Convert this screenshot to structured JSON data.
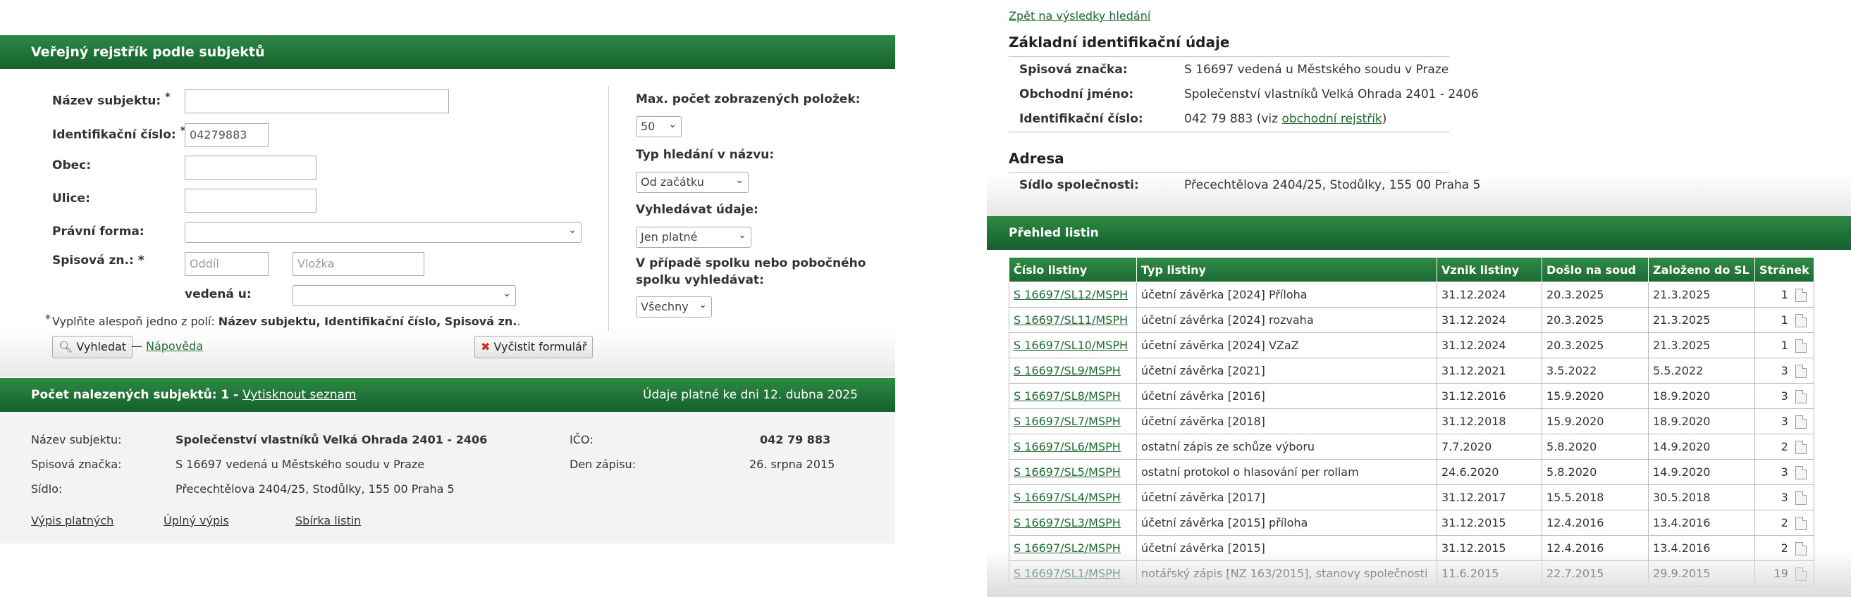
{
  "search": {
    "title": "Veřejný rejstřík podle subjektů",
    "labels": {
      "name": "Název subjektu:",
      "ico": "Identifikační číslo:",
      "city": "Obec:",
      "street": "Ulice:",
      "legal_form": "Právní forma:",
      "file_no": "Spisová zn.:",
      "court": "vedená u:",
      "required_mark": "*"
    },
    "values": {
      "name": "",
      "ico": "04279883",
      "city": "",
      "street": "",
      "legal_form": "",
      "court": ""
    },
    "placeholders": {
      "section": "Oddíl",
      "insert": "Vložka"
    },
    "options": {
      "max_label": "Max. počet zobrazených položek:",
      "max_value": "50",
      "type_label": "Typ hledání v názvu:",
      "type_value": "Od začátku",
      "data_label": "Vyhledávat údaje:",
      "data_value": "Jen platné",
      "assoc_label_1": "V případě spolku nebo pobočného",
      "assoc_label_2": "spolku vyhledávat:",
      "assoc_value": "Všechny"
    },
    "note_prefix": "Vyplňte alespoň jedno z polí:",
    "note_fields": "Název subjektu, Identifikační číslo, Spisová zn.",
    "note_end": ".",
    "search_button": "Vyhledat",
    "dash": "—",
    "help_link": "Nápověda",
    "clear_button": "Vyčistit formulář"
  },
  "results": {
    "count_label": "Počet nalezených subjektů: 1 -",
    "print_link": "Vytisknout seznam",
    "valid_note": "Údaje platné ke dni 12. dubna 2025",
    "name_label": "Název subjektu:",
    "name_value": "Společenství vlastníků Velká Ohrada 2401 - 2406",
    "file_label": "Spisová značka:",
    "file_value": "S 16697 vedená u Městského soudu v Praze",
    "seat_label": "Sídlo:",
    "seat_value": "Přecechtělova 2404/25, Stodůlky, 155 00 Praha 5",
    "ico_label": "IČO:",
    "ico_value": "042 79 883",
    "date_label": "Den zápisu:",
    "date_value": "26. srpna 2015",
    "links": [
      "Výpis platných",
      "Úplný výpis",
      "Sbírka listin"
    ]
  },
  "detail": {
    "back_link": "Zpět na výsledky hledání",
    "basic_title": "Základní identifikační údaje",
    "file_label": "Spisová značka:",
    "file_value": "S 16697 vedená u Městského soudu v Praze",
    "name_label": "Obchodní jméno:",
    "name_value": "Společenství vlastníků Velká Ohrada 2401 - 2406",
    "ico_label": "Identifikační číslo:",
    "ico_value": "042 79 883 (viz",
    "ico_link": "obchodní rejstřík",
    "ico_end": ")",
    "address_title": "Adresa",
    "seat_label": "Sídlo společnosti:",
    "seat_value": "Přecechtělova 2404/25, Stodůlky, 155 00 Praha 5"
  },
  "listiny": {
    "title": "Přehled listin",
    "columns": [
      "Číslo listiny",
      "Typ listiny",
      "Vznik listiny",
      "Došlo na soud",
      "Založeno do SL",
      "Stránek"
    ],
    "rows": [
      [
        "S 16697/SL12/MSPH",
        "účetní závěrka [2024] Příloha",
        "31.12.2024",
        "20.3.2025",
        "21.3.2025",
        "1"
      ],
      [
        "S 16697/SL11/MSPH",
        "účetní závěrka [2024] rozvaha",
        "31.12.2024",
        "20.3.2025",
        "21.3.2025",
        "1"
      ],
      [
        "S 16697/SL10/MSPH",
        "účetní závěrka [2024] VZaZ",
        "31.12.2024",
        "20.3.2025",
        "21.3.2025",
        "1"
      ],
      [
        "S 16697/SL9/MSPH",
        "účetní závěrka [2021]",
        "31.12.2021",
        "3.5.2022",
        "5.5.2022",
        "3"
      ],
      [
        "S 16697/SL8/MSPH",
        "účetní závěrka [2016]",
        "31.12.2016",
        "15.9.2020",
        "18.9.2020",
        "3"
      ],
      [
        "S 16697/SL7/MSPH",
        "účetní závěrka [2018]",
        "31.12.2018",
        "15.9.2020",
        "18.9.2020",
        "3"
      ],
      [
        "S 16697/SL6/MSPH",
        "ostatní zápis ze schůze výboru",
        "7.7.2020",
        "5.8.2020",
        "14.9.2020",
        "2"
      ],
      [
        "S 16697/SL5/MSPH",
        "ostatní protokol o hlasování per rollam",
        "24.6.2020",
        "5.8.2020",
        "14.9.2020",
        "3"
      ],
      [
        "S 16697/SL4/MSPH",
        "účetní závěrka [2017]",
        "31.12.2017",
        "15.5.2018",
        "30.5.2018",
        "3"
      ],
      [
        "S 16697/SL3/MSPH",
        "účetní závěrka [2015] příloha",
        "31.12.2015",
        "12.4.2016",
        "13.4.2016",
        "2"
      ],
      [
        "S 16697/SL2/MSPH",
        "účetní závěrka [2015]",
        "31.12.2015",
        "12.4.2016",
        "13.4.2016",
        "2"
      ],
      [
        "S 16697/SL1/MSPH",
        "notářský zápis [NZ 163/2015], stanovy společnosti",
        "11.6.2015",
        "22.7.2015",
        "29.9.2015",
        "19"
      ]
    ]
  }
}
